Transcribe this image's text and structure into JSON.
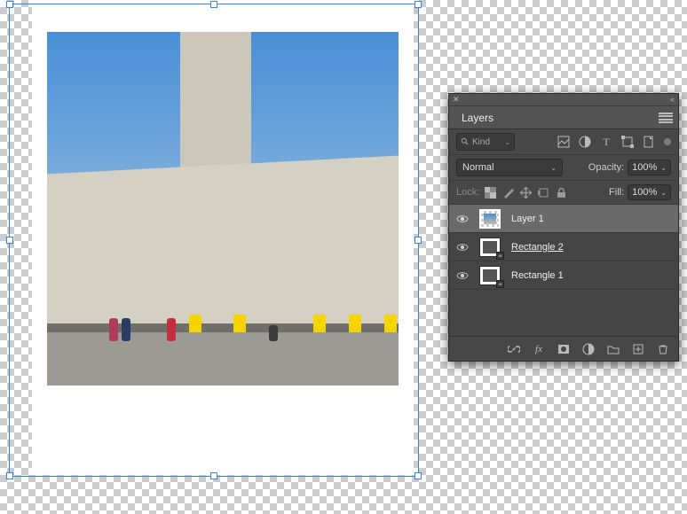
{
  "panel": {
    "title": "Layers",
    "filter": {
      "kind_label": "Kind"
    },
    "blend": {
      "mode": "Normal",
      "opacity_label": "Opacity:",
      "opacity_value": "100%"
    },
    "lock": {
      "label": "Lock:",
      "fill_label": "Fill:",
      "fill_value": "100%"
    },
    "layers": [
      {
        "name": "Layer 1",
        "visible": true,
        "selected": true,
        "type": "raster"
      },
      {
        "name": "Rectangle 2",
        "visible": true,
        "selected": false,
        "type": "shape",
        "underlined": true
      },
      {
        "name": "Rectangle 1",
        "visible": true,
        "selected": false,
        "type": "shape"
      }
    ]
  }
}
